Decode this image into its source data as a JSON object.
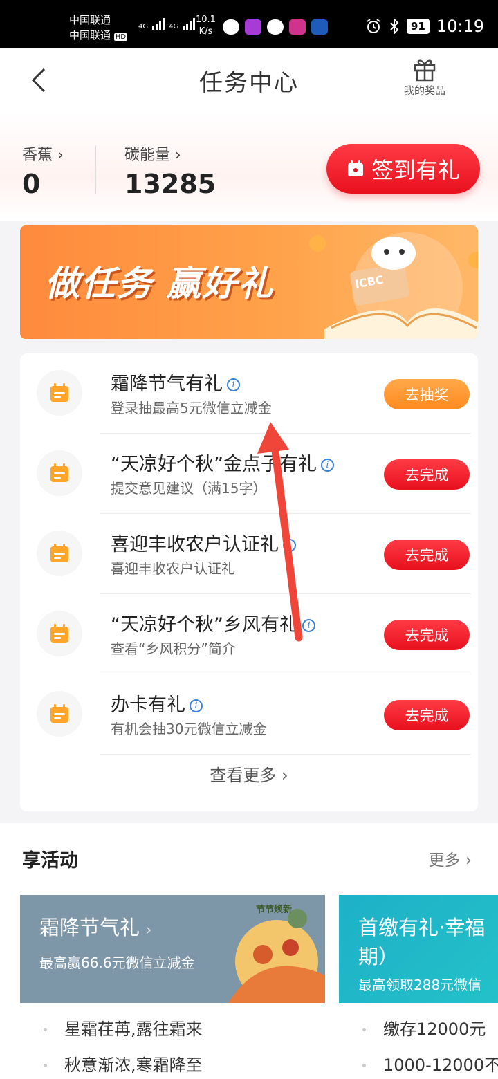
{
  "status_bar": {
    "carrier1": "中国联通",
    "carrier2": "中国联通",
    "hd": "HD",
    "net1": "4G",
    "net2": "4G",
    "speed_value": "10.1",
    "speed_unit": "K/s",
    "battery": "91",
    "time": "10:19"
  },
  "header": {
    "title": "任务中心",
    "prize_label": "我的奖品"
  },
  "stats": {
    "banana_label": "香蕉",
    "banana_value": "0",
    "carbon_label": "碳能量",
    "carbon_value": "13285"
  },
  "signin_label": "签到有礼",
  "banner": {
    "text": "做任务 赢好礼",
    "logo_text": "ICBC"
  },
  "tasks": [
    {
      "name": "霜降节气有礼",
      "desc": "登录抽最高5元微信立减金",
      "button": "去抽奖"
    },
    {
      "name": "“天凉好个秋”金点子有礼",
      "desc": "提交意见建议（满15字）",
      "button": "去完成"
    },
    {
      "name": "喜迎丰收农户认证礼",
      "desc": "喜迎丰收农户认证礼",
      "button": "去完成"
    },
    {
      "name": "“天凉好个秋”乡风有礼",
      "desc": "查看“乡风积分”简介",
      "button": "去完成"
    },
    {
      "name": "办卡有礼",
      "desc": "有机会抽30元微信立减金",
      "button": "去完成"
    }
  ],
  "see_more": "查看更多",
  "activities": {
    "title": "享活动",
    "more": "更多",
    "cards": [
      {
        "title": "霜降节气礼",
        "subtitle": "最高赢66.6元微信立减金",
        "badge": "节节焕新",
        "items": [
          "星霜荏苒,露往霜来",
          "秋意渐浓,寒霜降至"
        ]
      },
      {
        "title": "首缴有礼·幸福",
        "title2": "期）",
        "subtitle": "最高领取288元微信",
        "items": [
          "缴存12000元",
          "1000-12000不"
        ]
      }
    ]
  },
  "colors": {
    "accent_red": "#e8101d",
    "accent_orange": "#ff8a1f",
    "info_blue": "#3a83d8"
  }
}
